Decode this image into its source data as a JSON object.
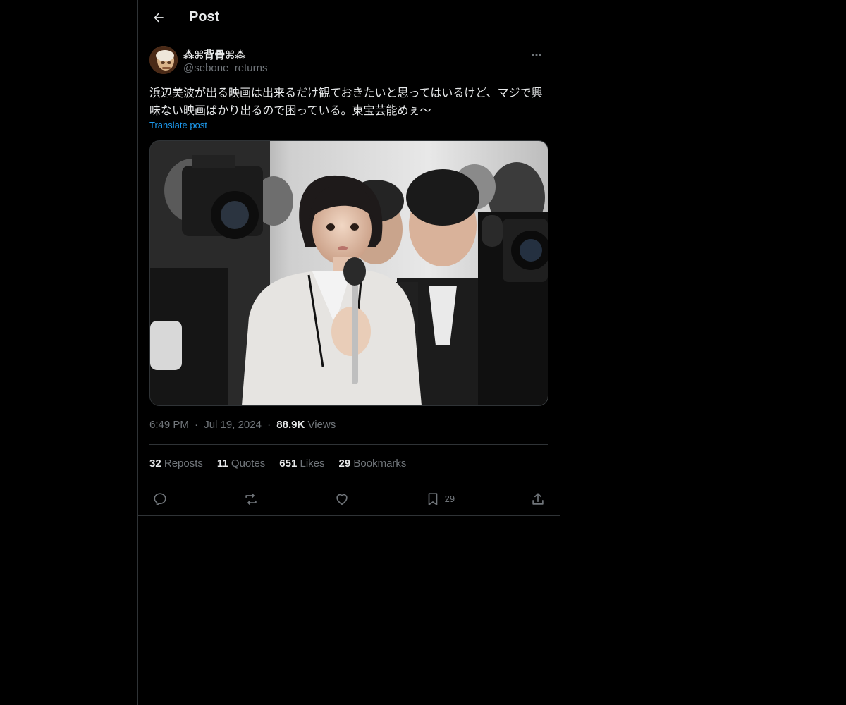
{
  "header": {
    "title": "Post"
  },
  "tweet": {
    "author": {
      "display_name": "⁂⌘背骨⌘⁂",
      "handle": "@sebone_returns"
    },
    "text": "浜辺美波が出る映画は出来るだけ観ておきたいと思ってはいるけど、マジで興味ない映画ばかり出るので困っている。東宝芸能めぇ〜",
    "translate_label": "Translate post",
    "time": "6:49 PM",
    "separator": "·",
    "date": "Jul 19, 2024",
    "views_count": "88.9K",
    "views_label": "Views",
    "stats": {
      "reposts_count": "32",
      "reposts_label": "Reposts",
      "quotes_count": "11",
      "quotes_label": "Quotes",
      "likes_count": "651",
      "likes_label": "Likes",
      "bookmarks_count": "29",
      "bookmarks_label": "Bookmarks"
    },
    "actions": {
      "bookmark_count": "29"
    }
  },
  "icons": {
    "back": "arrow-left-icon",
    "more": "more-horizontal-icon",
    "reply": "reply-icon",
    "repost": "repost-icon",
    "like": "heart-icon",
    "bookmark": "bookmark-icon",
    "share": "share-icon"
  },
  "colors": {
    "background": "#000000",
    "text_primary": "#e7e9ea",
    "text_secondary": "#71767b",
    "link": "#1d9bf0",
    "border": "#2f3336"
  }
}
